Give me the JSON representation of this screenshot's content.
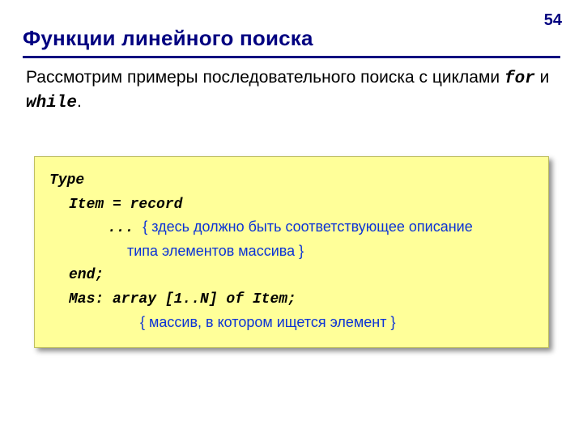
{
  "page_number": "54",
  "title": "Функции линейного поиска",
  "intro": {
    "part1": "Рассмотрим примеры последовательного поиска с циклами ",
    "kw_for": "for",
    "sep": " и ",
    "kw_while": "while",
    "tail": "."
  },
  "code": {
    "l1": "Type",
    "l2": "Item = record",
    "l3_kw": "... ",
    "l3_cmt": "{ здесь должно быть соответствующее описание",
    "l4_cmt": "типа элементов массива }",
    "l5": "end;",
    "l6": "Mas: array [1..N] of Item;",
    "l7_cmt": "{ массив, в котором ищется элемент }"
  }
}
